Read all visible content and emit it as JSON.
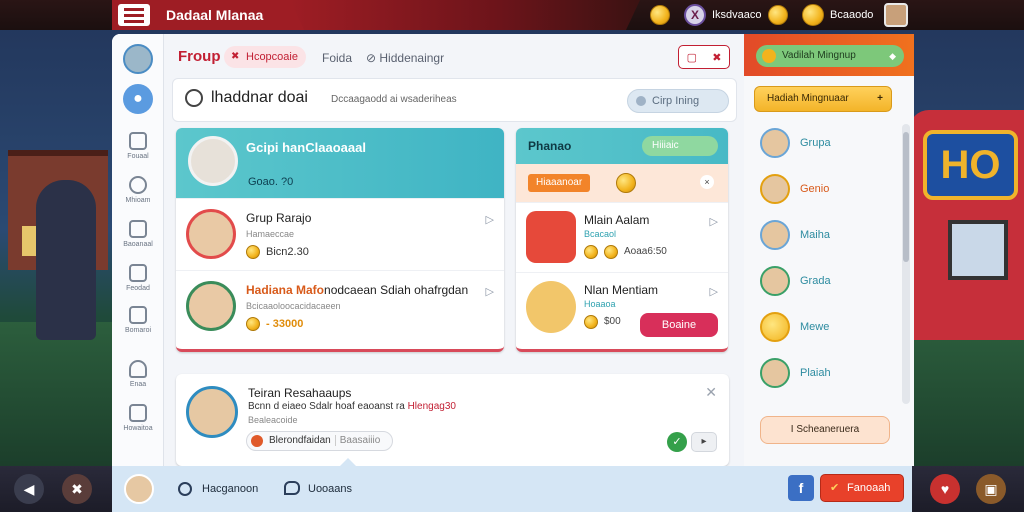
{
  "top_bar": {
    "brand": "Dadaal Mlanaa",
    "label_1": "Iksdvaaco",
    "label_2": "Bcaaodo"
  },
  "tabs": {
    "active": "Froup",
    "pill": "Hcopcoaie",
    "tab_2": "Foida",
    "tab_3": "Hiddenaingr"
  },
  "search": {
    "title": "lhaddnar doai",
    "subtitle": "Dccaagaodd ai wsaderiheas",
    "button": "Cirp Ining"
  },
  "left_card": {
    "header_title": "Gcipi hanClaaoaaal",
    "header_sub": "Goao. ?0",
    "rows": [
      {
        "name": "Grup Rarajo",
        "sub": "Hamaeccae",
        "value": "Bicn2.30"
      },
      {
        "name": "Hadiana Mafonodcaean Sdiah ohafrgdan",
        "sub": "Bcicaaoloocacidacaeen",
        "value": "- 33000"
      }
    ]
  },
  "middle_card": {
    "header_title": "Phanao",
    "header_button": "Hiiiaic",
    "banner_chip": "Hiaaanoar",
    "rows": [
      {
        "name": "Mlain Aalam",
        "sub": "Bcacaol",
        "value": "Aoaa6:50"
      },
      {
        "name": "Nlan Mentiam",
        "sub": "Hoaaoa",
        "value": "$00",
        "button": "Boaine"
      }
    ]
  },
  "bottom_card": {
    "title": "Teiran Resahaaups",
    "line_prefix": "Bcnn d eiaeo Sdalr hoaf eaoanst ra",
    "line_highlight": "Hlengag30",
    "line_2": "Bealeacoide",
    "chip_label": "Blerondfaidan",
    "chip_tag": "Baasaiiio"
  },
  "right_panel": {
    "header_pill": "Vadilah Mingnup",
    "yellow_button": "Hadiah Mingnuaar",
    "items": [
      "Grupa",
      "Genio",
      "Maiha",
      "Grada",
      "Mewe",
      "Plaiah"
    ],
    "bottom_button": "I Scheaneruera"
  },
  "rail": {
    "items": [
      "Fouaal",
      "Mhioam",
      "Baoanaal",
      "Feodad",
      "Bomaroi",
      "Enaa",
      "Howaitoa"
    ]
  },
  "bottom_bar": {
    "item_1": "Hacganoon",
    "item_2": "Uooaans",
    "action_button": "Fanoaah"
  },
  "colors": {
    "brand_red": "#9e1d24",
    "accent_teal": "#5cc7cc",
    "accent_orange": "#f0711e",
    "gold": "#f2b31d"
  }
}
